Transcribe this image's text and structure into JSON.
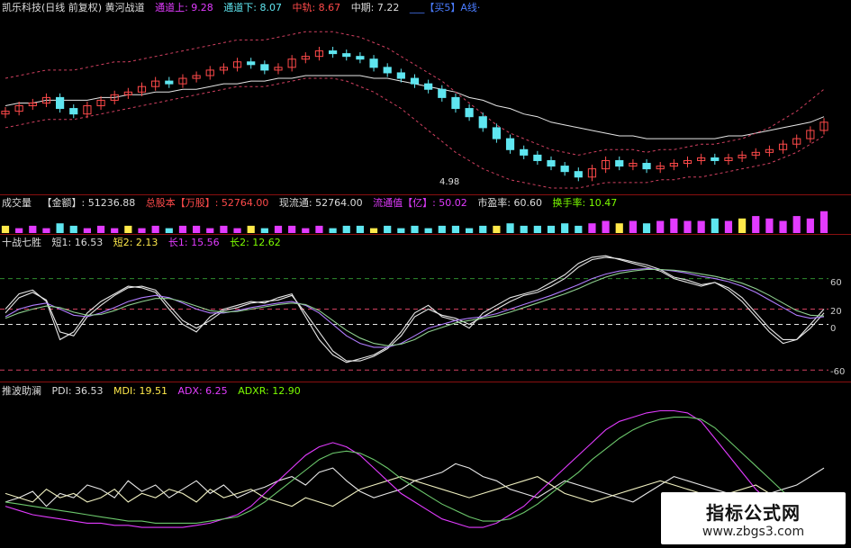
{
  "colors": {
    "bg": "#000000",
    "up": "#ff4a4a",
    "down": "#5fe6f0",
    "yellow": "#ffe94a",
    "magenta": "#e23bff",
    "green": "#7cfc00",
    "white": "#e6e6e6",
    "separator": "#8a1010",
    "dashed_pink": "#d04060"
  },
  "price_panel": {
    "title": "凯乐科技(日线 前复权) 黄河战道",
    "ch_up_label": "通道上: 9.28",
    "ch_down_label": "通道下: 8.07",
    "mid_label": "中轨: 8.67",
    "mid_term_label": "中期: 7.22",
    "extra_label": "___【买5】A线·",
    "low_price_annotation": "4.98"
  },
  "volume_panel": {
    "title": "成交量",
    "amount_label": "【金额】: 51236.88",
    "total_shares_label": "总股本【万股】: 52764.00",
    "float_label": "现流通: 52764.00",
    "float_value_label": "流通值【亿】: 50.02",
    "pe_label": "市盈率: 60.60",
    "turnover_label": "换手率: 10.47"
  },
  "kdj_panel": {
    "title": "十战七胜",
    "short1_label": "短1: 16.53",
    "short2_label": "短2: 2.13",
    "long1_label": "长1: 15.56",
    "long2_label": "长2: 12.62",
    "tick_labels": [
      "60",
      "20",
      "0",
      "-60"
    ]
  },
  "dmi_panel": {
    "title": "推波助澜",
    "pdi_label": "PDI: 36.53",
    "mdi_label": "MDI: 19.51",
    "adx_label": "ADX: 6.25",
    "adxr_label": "ADXR: 12.90"
  },
  "watermark": {
    "title": "指标公式网",
    "url": "www.zbgs3.com"
  },
  "chart_data": [
    {
      "type": "candlestick",
      "title": "凯乐科技(日线 前复权) 黄河战道",
      "series": [
        {
          "name": "close",
          "values": [
            7.4,
            7.6,
            7.7,
            7.9,
            7.5,
            7.3,
            7.6,
            7.8,
            8.0,
            8.1,
            8.3,
            8.5,
            8.4,
            8.6,
            8.7,
            8.9,
            9.0,
            9.2,
            9.1,
            8.9,
            9.0,
            9.3,
            9.4,
            9.6,
            9.5,
            9.4,
            9.3,
            9.0,
            8.8,
            8.6,
            8.4,
            8.2,
            7.9,
            7.5,
            7.2,
            6.8,
            6.4,
            6.0,
            5.8,
            5.6,
            5.4,
            5.2,
            5.0,
            5.3,
            5.6,
            5.4,
            5.5,
            5.3,
            5.4,
            5.5,
            5.6,
            5.7,
            5.6,
            5.7,
            5.8,
            5.9,
            6.0,
            6.2,
            6.4,
            6.7,
            7.0
          ]
        },
        {
          "name": "通道上",
          "values": [
            8.6,
            8.7,
            8.8,
            8.9,
            8.9,
            8.9,
            9.0,
            9.1,
            9.2,
            9.2,
            9.3,
            9.4,
            9.5,
            9.6,
            9.7,
            9.8,
            9.9,
            10.0,
            10.0,
            10.0,
            10.1,
            10.2,
            10.3,
            10.3,
            10.3,
            10.2,
            10.1,
            9.9,
            9.7,
            9.4,
            9.1,
            8.8,
            8.5,
            8.1,
            7.7,
            7.3,
            6.9,
            6.6,
            6.4,
            6.2,
            6.0,
            5.9,
            5.8,
            5.9,
            6.0,
            6.0,
            6.0,
            5.9,
            6.0,
            6.0,
            6.1,
            6.2,
            6.2,
            6.3,
            6.4,
            6.6,
            6.8,
            7.1,
            7.4,
            7.8,
            8.2
          ]
        },
        {
          "name": "通道下",
          "values": [
            6.8,
            6.9,
            7.0,
            7.1,
            7.1,
            7.1,
            7.2,
            7.3,
            7.4,
            7.5,
            7.6,
            7.7,
            7.8,
            7.9,
            8.0,
            8.1,
            8.2,
            8.3,
            8.3,
            8.3,
            8.4,
            8.5,
            8.6,
            8.6,
            8.6,
            8.5,
            8.3,
            8.1,
            7.8,
            7.5,
            7.1,
            6.7,
            6.3,
            5.9,
            5.6,
            5.3,
            5.1,
            4.9,
            4.8,
            4.7,
            4.6,
            4.6,
            4.6,
            4.7,
            4.8,
            4.8,
            4.8,
            4.8,
            4.9,
            4.9,
            5.0,
            5.0,
            5.1,
            5.2,
            5.3,
            5.4,
            5.5,
            5.7,
            5.9,
            6.2,
            6.5
          ]
        },
        {
          "name": "中期",
          "values": [
            7.6,
            7.7,
            7.7,
            7.8,
            7.8,
            7.8,
            7.8,
            7.9,
            7.9,
            8.0,
            8.0,
            8.1,
            8.1,
            8.2,
            8.2,
            8.3,
            8.4,
            8.4,
            8.5,
            8.5,
            8.6,
            8.6,
            8.7,
            8.7,
            8.7,
            8.7,
            8.7,
            8.6,
            8.6,
            8.5,
            8.4,
            8.3,
            8.2,
            8.1,
            7.9,
            7.8,
            7.6,
            7.5,
            7.3,
            7.2,
            7.0,
            6.9,
            6.8,
            6.7,
            6.6,
            6.5,
            6.5,
            6.4,
            6.4,
            6.4,
            6.4,
            6.4,
            6.4,
            6.5,
            6.5,
            6.6,
            6.7,
            6.8,
            6.9,
            7.0,
            7.2
          ]
        }
      ]
    },
    {
      "type": "bar",
      "title": "成交量",
      "series": [
        {
          "name": "volume",
          "values": [
            3,
            2,
            3,
            2,
            4,
            3,
            2,
            3,
            2,
            3,
            2,
            3,
            2,
            3,
            3,
            2,
            3,
            2,
            3,
            2,
            3,
            3,
            2,
            3,
            2,
            3,
            3,
            2,
            3,
            2,
            3,
            2,
            3,
            3,
            2,
            3,
            3,
            4,
            3,
            3,
            3,
            4,
            3,
            4,
            5,
            4,
            5,
            4,
            5,
            6,
            5,
            5,
            6,
            5,
            6,
            7,
            6,
            5,
            7,
            6,
            9
          ]
        }
      ]
    },
    {
      "type": "line",
      "title": "十战七胜",
      "ylim": [
        -75,
        95
      ],
      "series": [
        {
          "name": "短1",
          "values": [
            20,
            40,
            45,
            30,
            -20,
            -10,
            15,
            30,
            40,
            50,
            48,
            42,
            20,
            0,
            -10,
            10,
            20,
            25,
            30,
            28,
            35,
            40,
            10,
            -20,
            -40,
            -50,
            -45,
            -40,
            -30,
            -10,
            15,
            25,
            10,
            5,
            -5,
            15,
            25,
            35,
            40,
            45,
            55,
            65,
            80,
            88,
            90,
            85,
            80,
            75,
            70,
            60,
            55,
            50,
            55,
            45,
            30,
            10,
            -10,
            -25,
            -20,
            0,
            20
          ]
        },
        {
          "name": "短2",
          "values": [
            15,
            35,
            42,
            32,
            -10,
            -15,
            10,
            25,
            38,
            48,
            50,
            45,
            25,
            5,
            -5,
            5,
            18,
            22,
            28,
            30,
            32,
            38,
            15,
            -10,
            -35,
            -48,
            -48,
            -42,
            -32,
            -15,
            10,
            20,
            12,
            8,
            0,
            10,
            20,
            30,
            38,
            42,
            50,
            60,
            75,
            85,
            88,
            86,
            82,
            78,
            72,
            62,
            58,
            52,
            55,
            48,
            35,
            15,
            -5,
            -20,
            -20,
            -5,
            15
          ]
        },
        {
          "name": "长1",
          "values": [
            10,
            20,
            25,
            28,
            20,
            12,
            10,
            15,
            22,
            30,
            35,
            38,
            35,
            28,
            20,
            15,
            15,
            18,
            22,
            25,
            28,
            30,
            25,
            15,
            0,
            -15,
            -25,
            -30,
            -30,
            -25,
            -15,
            -5,
            0,
            5,
            8,
            10,
            14,
            20,
            26,
            32,
            38,
            45,
            52,
            60,
            66,
            70,
            72,
            73,
            72,
            70,
            67,
            63,
            60,
            56,
            50,
            42,
            32,
            22,
            12,
            8,
            10
          ]
        },
        {
          "name": "长2",
          "values": [
            8,
            15,
            20,
            24,
            22,
            16,
            12,
            13,
            18,
            25,
            30,
            34,
            34,
            30,
            24,
            18,
            16,
            17,
            20,
            23,
            26,
            28,
            26,
            18,
            5,
            -8,
            -18,
            -25,
            -28,
            -26,
            -20,
            -10,
            -4,
            2,
            5,
            8,
            11,
            16,
            22,
            28,
            34,
            40,
            47,
            55,
            62,
            67,
            70,
            72,
            72,
            71,
            69,
            66,
            63,
            59,
            54,
            47,
            38,
            28,
            18,
            12,
            11
          ]
        }
      ]
    },
    {
      "type": "line",
      "title": "推波助澜",
      "ylim": [
        0,
        70
      ],
      "series": [
        {
          "name": "PDI",
          "values": [
            20,
            22,
            25,
            18,
            24,
            22,
            28,
            26,
            22,
            30,
            25,
            28,
            22,
            26,
            30,
            24,
            28,
            22,
            25,
            27,
            30,
            32,
            28,
            34,
            36,
            30,
            25,
            22,
            24,
            26,
            30,
            32,
            34,
            38,
            36,
            32,
            30,
            26,
            24,
            22,
            26,
            30,
            28,
            26,
            24,
            22,
            20,
            24,
            28,
            32,
            30,
            28,
            26,
            24,
            22,
            20,
            24,
            26,
            28,
            32,
            36
          ]
        },
        {
          "name": "MDI",
          "values": [
            24,
            22,
            20,
            26,
            22,
            24,
            20,
            22,
            26,
            20,
            24,
            22,
            26,
            24,
            20,
            26,
            22,
            24,
            26,
            22,
            20,
            18,
            22,
            20,
            18,
            22,
            26,
            28,
            30,
            32,
            30,
            28,
            26,
            24,
            22,
            24,
            26,
            28,
            30,
            32,
            28,
            24,
            22,
            20,
            22,
            24,
            26,
            28,
            30,
            28,
            26,
            24,
            22,
            24,
            26,
            28,
            24,
            22,
            20,
            18,
            19
          ]
        },
        {
          "name": "ADX",
          "values": [
            18,
            16,
            14,
            13,
            12,
            11,
            10,
            10,
            9,
            9,
            8,
            8,
            8,
            8,
            9,
            10,
            12,
            14,
            18,
            24,
            30,
            36,
            42,
            46,
            48,
            46,
            42,
            36,
            30,
            24,
            20,
            16,
            12,
            10,
            8,
            8,
            10,
            14,
            18,
            24,
            30,
            36,
            42,
            48,
            54,
            58,
            60,
            62,
            63,
            63,
            62,
            58,
            50,
            42,
            34,
            26,
            20,
            14,
            10,
            7,
            6
          ]
        },
        {
          "name": "ADXR",
          "values": [
            20,
            19,
            18,
            17,
            16,
            15,
            14,
            13,
            12,
            11,
            11,
            10,
            10,
            10,
            10,
            11,
            12,
            13,
            16,
            20,
            25,
            30,
            35,
            40,
            43,
            44,
            43,
            40,
            36,
            31,
            27,
            23,
            19,
            16,
            13,
            11,
            11,
            12,
            15,
            19,
            24,
            29,
            34,
            40,
            45,
            50,
            54,
            57,
            59,
            60,
            60,
            59,
            55,
            49,
            43,
            37,
            31,
            25,
            20,
            15,
            13
          ]
        }
      ]
    }
  ]
}
